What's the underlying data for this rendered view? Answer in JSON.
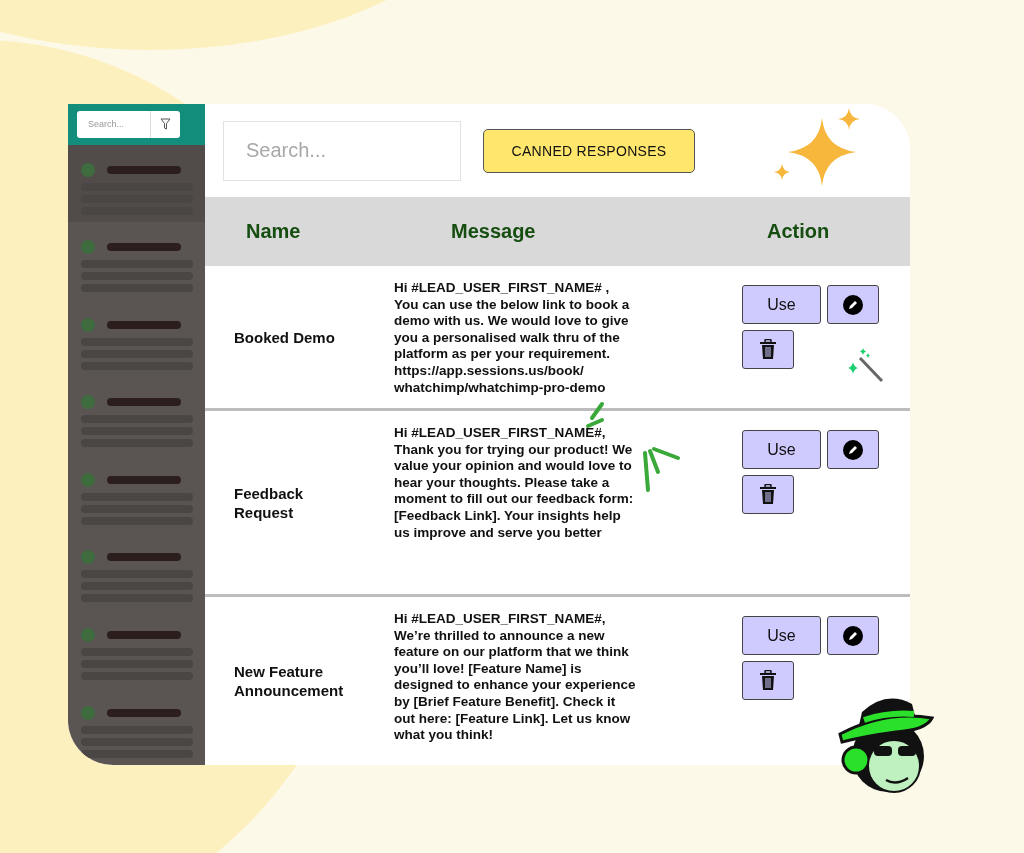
{
  "sidebar": {
    "search": {
      "placeholder": "Search..."
    }
  },
  "toolbar": {
    "search": {
      "placeholder": "Search..."
    },
    "button": "CANNED RESPONSES"
  },
  "table": {
    "columns": [
      "Name",
      "Message",
      "Action"
    ],
    "rows": [
      {
        "name": "Booked Demo",
        "message": "Hi #LEAD_USER_FIRST_NAME# , You can use the below link to book a demo with us. We would love to give you a personalised walk thru of the platform as per your requirement. https://app.sessions.us/book/ whatchimp/whatchimp-pro-demo",
        "use": "Use"
      },
      {
        "name": "Feedback Request",
        "message": "Hi #LEAD_USER_FIRST_NAME#, Thank you for trying our product! We value your opinion and would love to hear your thoughts. Please take a moment to fill out our feedback form: [Feedback Link]. Your insights help us improve and serve you better",
        "use": "Use"
      },
      {
        "name": "New Feature Announcement",
        "message": "Hi #LEAD_USER_FIRST_NAME#, We’re thrilled to announce a new feature on our platform that we think you’ll love! [Feature Name] is designed to enhance your experience by [Brief Feature Benefit]. Check it out here: [Feature Link]. Let us know what you think!",
        "use": "Use"
      }
    ]
  }
}
